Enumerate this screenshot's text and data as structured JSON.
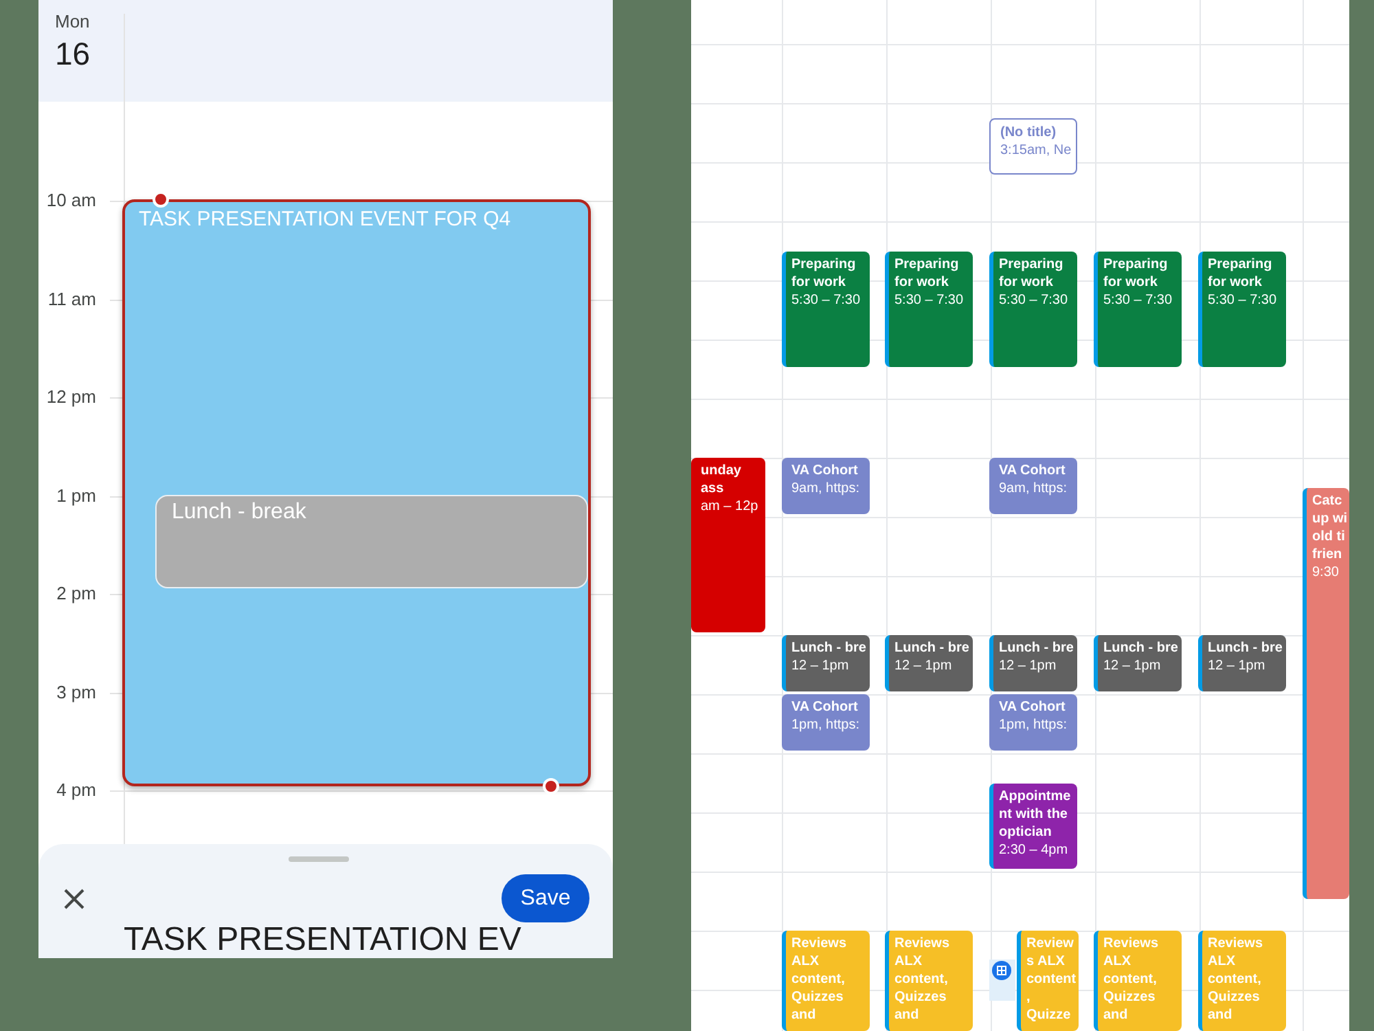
{
  "day_view": {
    "weekday": "Mon",
    "date": "16",
    "hours": [
      "10 am",
      "11 am",
      "12 pm",
      "1 pm",
      "2 pm",
      "3 pm",
      "4 pm"
    ],
    "events": [
      {
        "title": "TASK PRESENTATION EVENT FOR Q4",
        "color": "#81caf0",
        "selected": true
      },
      {
        "title": "Lunch - break",
        "color": "#adadad",
        "selected": false
      }
    ],
    "sheet": {
      "save": "Save",
      "title": "TASK PRESENTATION EV"
    }
  },
  "week_view": {
    "columns": [
      {
        "events": [
          {
            "kind": "filled",
            "title": "unday\nass",
            "time": "am – 12p",
            "color": "#d50000",
            "edge_stripe": false
          }
        ]
      },
      {
        "events": [
          {
            "kind": "filled",
            "title": "Preparing\nfor work",
            "time": "5:30 – 7:30",
            "color": "#0b8043",
            "edge_stripe": true
          },
          {
            "kind": "filled",
            "title": "VA Cohort",
            "time": "9am, https:",
            "color": "#7986cb",
            "edge_stripe": false
          },
          {
            "kind": "filled",
            "title": "Lunch - bre",
            "time": "12 – 1pm",
            "color": "#616161",
            "edge_stripe": true
          },
          {
            "kind": "filled",
            "title": "VA Cohort",
            "time": "1pm, https:",
            "color": "#7986cb",
            "edge_stripe": false
          },
          {
            "kind": "filled",
            "title": "Reviews\nALX\ncontent,\nQuizzes\nand",
            "color": "#f6bf26",
            "edge_stripe": true
          }
        ]
      },
      {
        "events": [
          {
            "kind": "filled",
            "title": "Preparing\nfor work",
            "time": "5:30 – 7:30",
            "color": "#0b8043",
            "edge_stripe": true
          },
          {
            "kind": "filled",
            "title": "Lunch - bre",
            "time": "12 – 1pm",
            "color": "#616161",
            "edge_stripe": true
          },
          {
            "kind": "filled",
            "title": "Reviews\nALX\ncontent,\nQuizzes\nand",
            "color": "#f6bf26",
            "edge_stripe": true
          }
        ]
      },
      {
        "events": [
          {
            "kind": "outlined",
            "title": "(No title)",
            "time": "3:15am, Ne",
            "color": "#7986cb",
            "edge_stripe": false
          },
          {
            "kind": "filled",
            "title": "Preparing\nfor work",
            "time": "5:30 – 7:30",
            "color": "#0b8043",
            "edge_stripe": true
          },
          {
            "kind": "filled",
            "title": "VA Cohort",
            "time": "9am, https:",
            "color": "#7986cb",
            "edge_stripe": false
          },
          {
            "kind": "filled",
            "title": "Lunch - bre",
            "time": "12 – 1pm",
            "color": "#616161",
            "edge_stripe": true
          },
          {
            "kind": "filled",
            "title": "VA Cohort",
            "time": "1pm, https:",
            "color": "#7986cb",
            "edge_stripe": false
          },
          {
            "kind": "filled",
            "title": "Appointme\nnt with the\noptician",
            "time": "2:30 – 4pm",
            "color": "#8e24aa",
            "edge_stripe": true
          },
          {
            "kind": "filled",
            "title": "Review\ns ALX\ncontent\n,\nQuizze",
            "color": "#f6bf26",
            "edge_stripe": true
          }
        ]
      },
      {
        "events": [
          {
            "kind": "filled",
            "title": "Preparing\nfor work",
            "time": "5:30 – 7:30",
            "color": "#0b8043",
            "edge_stripe": true
          },
          {
            "kind": "filled",
            "title": "Lunch - bre",
            "time": "12 – 1pm",
            "color": "#616161",
            "edge_stripe": true
          },
          {
            "kind": "filled",
            "title": "Reviews\nALX\ncontent,\nQuizzes\nand",
            "color": "#f6bf26",
            "edge_stripe": true
          }
        ]
      },
      {
        "events": [
          {
            "kind": "filled",
            "title": "Preparing\nfor work",
            "time": "5:30 – 7:30",
            "color": "#0b8043",
            "edge_stripe": true
          },
          {
            "kind": "filled",
            "title": "Lunch - bre",
            "time": "12 – 1pm",
            "color": "#616161",
            "edge_stripe": true
          },
          {
            "kind": "filled",
            "title": "Reviews\nALX\ncontent,\nQuizzes\nand",
            "color": "#f6bf26",
            "edge_stripe": true
          }
        ]
      },
      {
        "events": [
          {
            "kind": "filled",
            "title": "Catc\nup wi\nold ti\nfrien",
            "time": "9:30",
            "color": "#e67c73",
            "edge_stripe": true
          }
        ]
      }
    ]
  }
}
